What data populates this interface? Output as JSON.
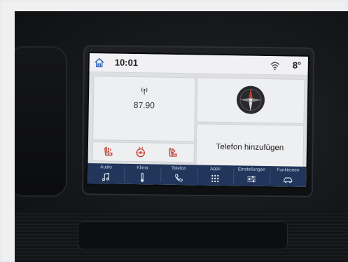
{
  "statusbar": {
    "time": "10:01",
    "temperature": "8°",
    "icons": [
      "home-icon",
      "wifi-icon"
    ]
  },
  "radio": {
    "frequency": "87.90",
    "icon": "radio-signal-icon"
  },
  "compass": {
    "icon": "compass-icon"
  },
  "phone": {
    "label": "Telefon hinzufügen"
  },
  "climate": {
    "buttons": [
      "seat-heat-left-icon",
      "steering-wheel-heat-icon",
      "seat-heat-right-icon"
    ]
  },
  "nav": {
    "items": [
      {
        "label": "Audio",
        "icon": "music-note-icon"
      },
      {
        "label": "Klima",
        "icon": "thermometer-icon"
      },
      {
        "label": "Telefon",
        "icon": "phone-icon"
      },
      {
        "label": "Apps",
        "icon": "apps-grid-icon"
      },
      {
        "label": "Einstellungen",
        "icon": "sliders-icon"
      },
      {
        "label": "Funktionen",
        "icon": "car-icon"
      }
    ]
  },
  "colors": {
    "nav_background": "#21365a",
    "screen_background": "#dedfe2",
    "accent_red": "#c0392b",
    "home_blue": "#2b5fb8"
  }
}
